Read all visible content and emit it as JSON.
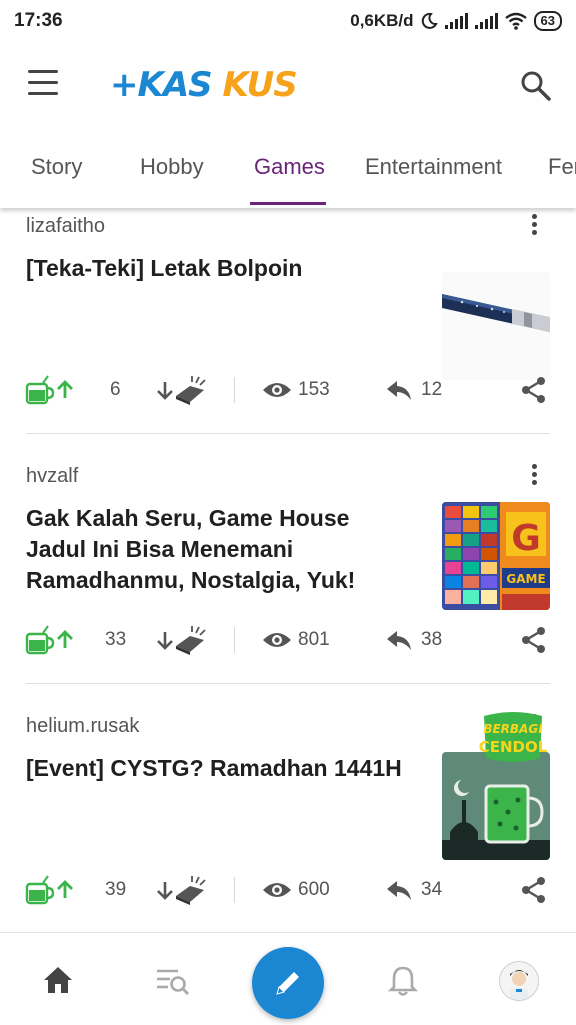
{
  "status_bar": {
    "time": "17:36",
    "speed": "0,6KB/d",
    "battery": "63"
  },
  "header": {
    "logo_text": "KASKUS"
  },
  "tabs": [
    {
      "label": "Story"
    },
    {
      "label": "Hobby"
    },
    {
      "label": "Games",
      "active": true
    },
    {
      "label": "Entertainment"
    },
    {
      "label": "Fem"
    }
  ],
  "posts": [
    {
      "author": "lizafaitho",
      "title": "[Teka-Teki] Letak Bolpoin",
      "upvotes": "6",
      "views": "153",
      "replies": "12",
      "thumbnail": "pen-photo"
    },
    {
      "author": "hvzalf",
      "title": "Gak Kalah Seru, Game House Jadul Ini Bisa Menemani Ramadhanmu, Nostalgia, Yuk!",
      "upvotes": "33",
      "views": "801",
      "replies": "38",
      "thumbnail": "game-house-collage"
    },
    {
      "author": "helium.rusak",
      "title": "[Event] CYSTG? Ramadhan 1441H",
      "upvotes": "39",
      "views": "600",
      "replies": "34",
      "thumbnail": "berbagi-cendol-banner",
      "badge_line1": "BERBAGI",
      "badge_line2": "CENDOL"
    }
  ],
  "bottom_nav": [
    {
      "icon": "home-icon",
      "active": true
    },
    {
      "icon": "feed-search-icon"
    },
    {
      "icon": "pencil-icon"
    },
    {
      "icon": "bell-icon"
    },
    {
      "icon": "avatar"
    }
  ],
  "colors": {
    "brand_blue": "#1b87d2",
    "brand_orange": "#f7a21b",
    "tab_active": "#6a2478",
    "cendol_green": "#3bb54a"
  }
}
